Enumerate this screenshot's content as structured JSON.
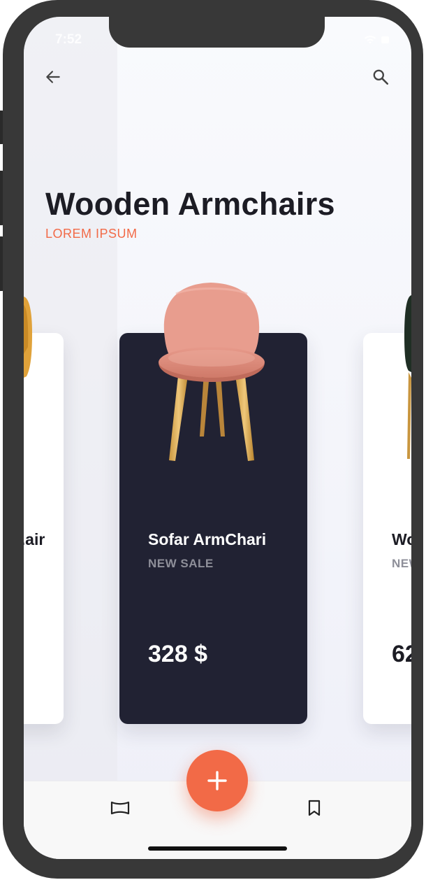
{
  "status_bar": {
    "time": "7:52"
  },
  "header": {
    "title": "Wooden Armchairs",
    "subtitle": "LOREM IPSUM"
  },
  "cards": [
    {
      "name": "...air",
      "tag": "",
      "price": ""
    },
    {
      "name": "Sofar ArmChari",
      "tag": "NEW SALE",
      "price": "328 $"
    },
    {
      "name": "Wo",
      "tag": "NEW",
      "price": "62"
    }
  ],
  "icons": {
    "back": "arrow-back-icon",
    "search": "search-icon",
    "fab": "plus-icon",
    "tab_left": "panorama-icon",
    "tab_right": "bookmark-icon"
  },
  "colors": {
    "accent": "#f26a47",
    "dark_card": "#212233",
    "title": "#1c1c24"
  }
}
